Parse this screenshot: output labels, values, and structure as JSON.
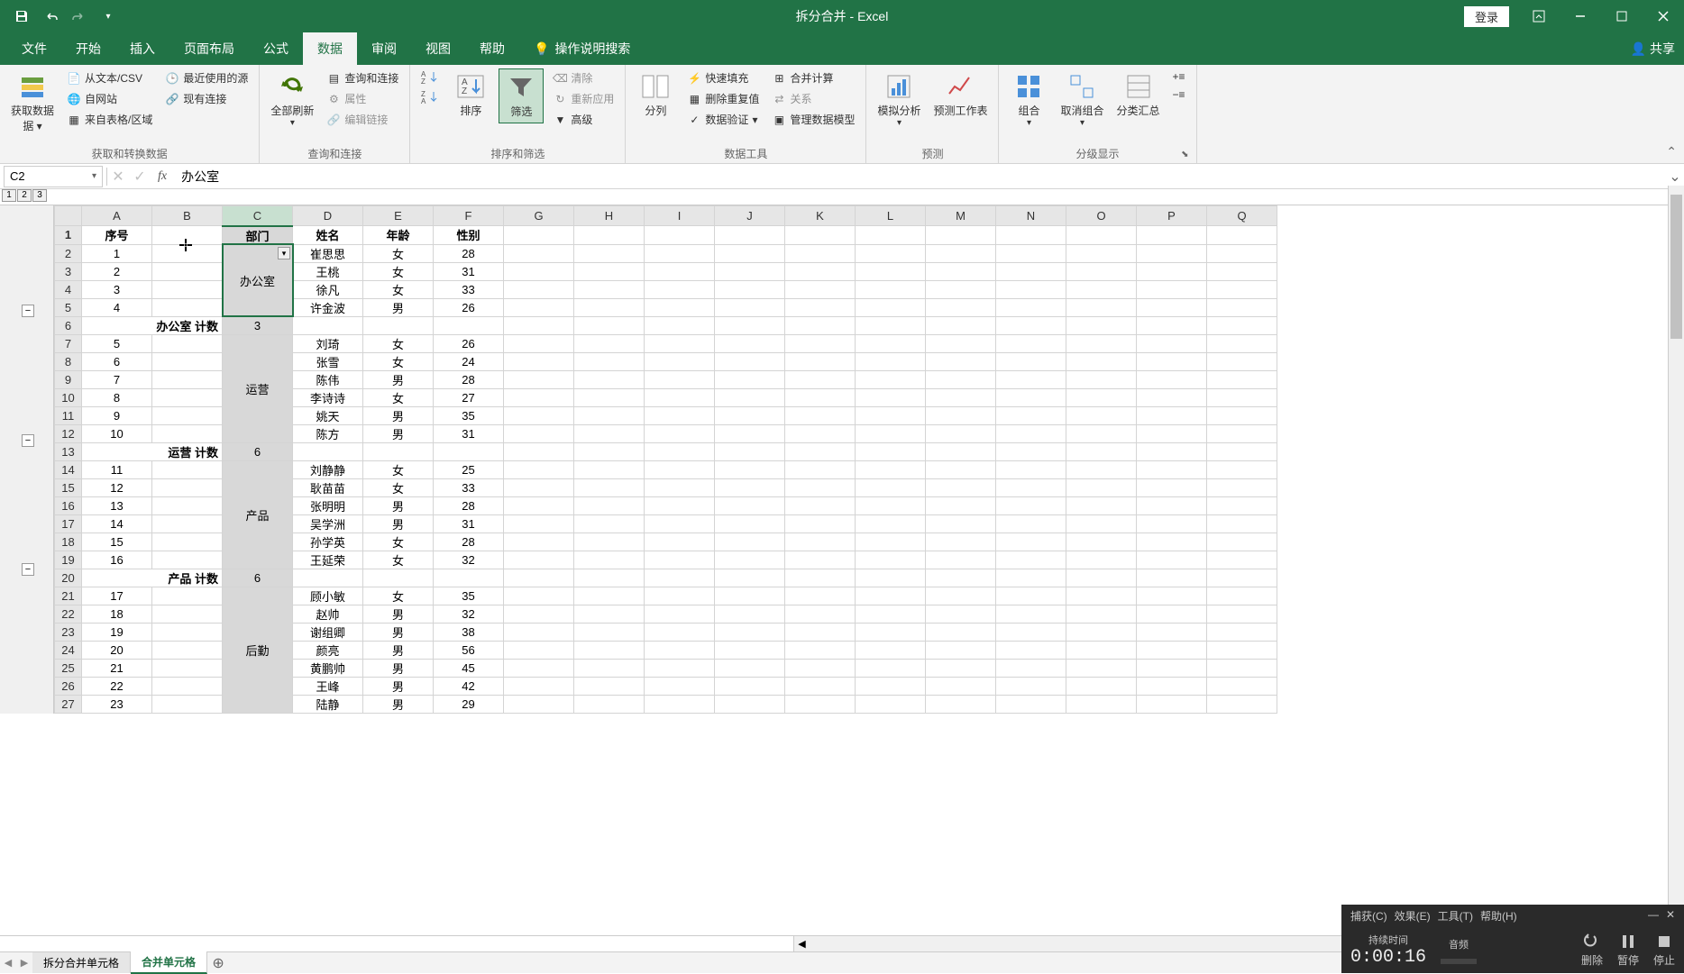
{
  "title_bar": {
    "doc_title": "拆分合并 - Excel",
    "login": "登录"
  },
  "tabs": {
    "file": "文件",
    "home": "开始",
    "insert": "插入",
    "layout": "页面布局",
    "formulas": "公式",
    "data": "数据",
    "review": "审阅",
    "view": "视图",
    "help": "帮助",
    "tell_me": "操作说明搜索",
    "share": "共享"
  },
  "ribbon": {
    "get_data": "获取数据",
    "from_text_csv": "从文本/CSV",
    "from_web": "自网站",
    "from_table": "来自表格/区域",
    "recent": "最近使用的源",
    "existing": "现有连接",
    "group_get": "获取和转换数据",
    "refresh_all": "全部刷新",
    "queries": "查询和连接",
    "properties": "属性",
    "edit_links": "编辑链接",
    "group_queries": "查询和连接",
    "sort": "排序",
    "filter": "筛选",
    "clear": "清除",
    "reapply": "重新应用",
    "advanced": "高级",
    "group_sort": "排序和筛选",
    "text_to_cols": "分列",
    "flash_fill": "快速填充",
    "remove_dup": "删除重复值",
    "data_valid": "数据验证",
    "consolidate": "合并计算",
    "relationships": "关系",
    "data_model": "管理数据模型",
    "group_tools": "数据工具",
    "whatif": "模拟分析",
    "forecast": "预测工作表",
    "group_forecast": "预测",
    "group_btn": "组合",
    "ungroup": "取消组合",
    "subtotal": "分类汇总",
    "group_outline": "分级显示"
  },
  "formula_bar": {
    "name_box": "C2",
    "formula_value": "办公室"
  },
  "outline_levels": [
    "1",
    "2",
    "3"
  ],
  "column_headers": [
    "A",
    "B",
    "C",
    "D",
    "E",
    "F",
    "G",
    "H",
    "I",
    "J",
    "K",
    "L",
    "M",
    "N",
    "O",
    "P",
    "Q"
  ],
  "row_headers": [
    "1",
    "2",
    "3",
    "4",
    "5",
    "6",
    "7",
    "8",
    "9",
    "10",
    "11",
    "12",
    "13",
    "14",
    "15",
    "16",
    "17",
    "18",
    "19",
    "20",
    "21",
    "22",
    "23",
    "24",
    "25",
    "26",
    "27"
  ],
  "headers": {
    "a": "序号",
    "b": "",
    "c": "部门",
    "d": "姓名",
    "e": "年龄",
    "f": "性别"
  },
  "rows": [
    {
      "n": "1",
      "dept": "办公室",
      "name": "崔思思",
      "age": "女",
      "sex": "28"
    },
    {
      "n": "2",
      "dept": "办公室",
      "name": "王桃",
      "age": "女",
      "sex": "31"
    },
    {
      "n": "3",
      "dept": "办公室",
      "name": "徐凡",
      "age": "女",
      "sex": "33"
    },
    {
      "n": "4",
      "dept": "办公室",
      "name": "许金波",
      "age": "男",
      "sex": "26"
    }
  ],
  "count1": {
    "label": "办公室 计数",
    "val": "3"
  },
  "rows2": [
    {
      "n": "5",
      "name": "刘琦",
      "age": "女",
      "sex": "26"
    },
    {
      "n": "6",
      "name": "张雪",
      "age": "女",
      "sex": "24"
    },
    {
      "n": "7",
      "name": "陈伟",
      "age": "男",
      "sex": "28"
    },
    {
      "n": "8",
      "name": "李诗诗",
      "age": "女",
      "sex": "27"
    },
    {
      "n": "9",
      "name": "姚天",
      "age": "男",
      "sex": "35"
    },
    {
      "n": "10",
      "name": "陈方",
      "age": "男",
      "sex": "31"
    }
  ],
  "dept2": "运营",
  "count2": {
    "label": "运营 计数",
    "val": "6"
  },
  "rows3": [
    {
      "n": "11",
      "name": "刘静静",
      "age": "女",
      "sex": "25"
    },
    {
      "n": "12",
      "name": "耿苗苗",
      "age": "女",
      "sex": "33"
    },
    {
      "n": "13",
      "name": "张明明",
      "age": "男",
      "sex": "28"
    },
    {
      "n": "14",
      "name": "吴学洲",
      "age": "男",
      "sex": "31"
    },
    {
      "n": "15",
      "name": "孙学英",
      "age": "女",
      "sex": "28"
    },
    {
      "n": "16",
      "name": "王延荣",
      "age": "女",
      "sex": "32"
    }
  ],
  "dept3": "产品",
  "count3": {
    "label": "产品 计数",
    "val": "6"
  },
  "rows4": [
    {
      "n": "17",
      "name": "顾小敏",
      "age": "女",
      "sex": "35"
    },
    {
      "n": "18",
      "name": "赵帅",
      "age": "男",
      "sex": "32"
    },
    {
      "n": "19",
      "name": "谢组卿",
      "age": "男",
      "sex": "38"
    },
    {
      "n": "20",
      "name": "颜亮",
      "age": "男",
      "sex": "56"
    },
    {
      "n": "21",
      "name": "黄鹏帅",
      "age": "男",
      "sex": "45"
    },
    {
      "n": "22",
      "name": "王峰",
      "age": "男",
      "sex": "42"
    },
    {
      "n": "23",
      "name": "陆静",
      "age": "男",
      "sex": "29"
    }
  ],
  "dept4": "后勤",
  "sheet_tabs": {
    "tab1": "拆分合并单元格",
    "tab2": "合并单元格"
  },
  "recorder": {
    "menu": {
      "capture": "捕获(C)",
      "effect": "效果(E)",
      "tool": "工具(T)",
      "help": "帮助(H)"
    },
    "duration_label": "持续时间",
    "duration": "0:00:16",
    "audio": "音频",
    "delete": "删除",
    "pause": "暂停",
    "stop": "停止"
  }
}
